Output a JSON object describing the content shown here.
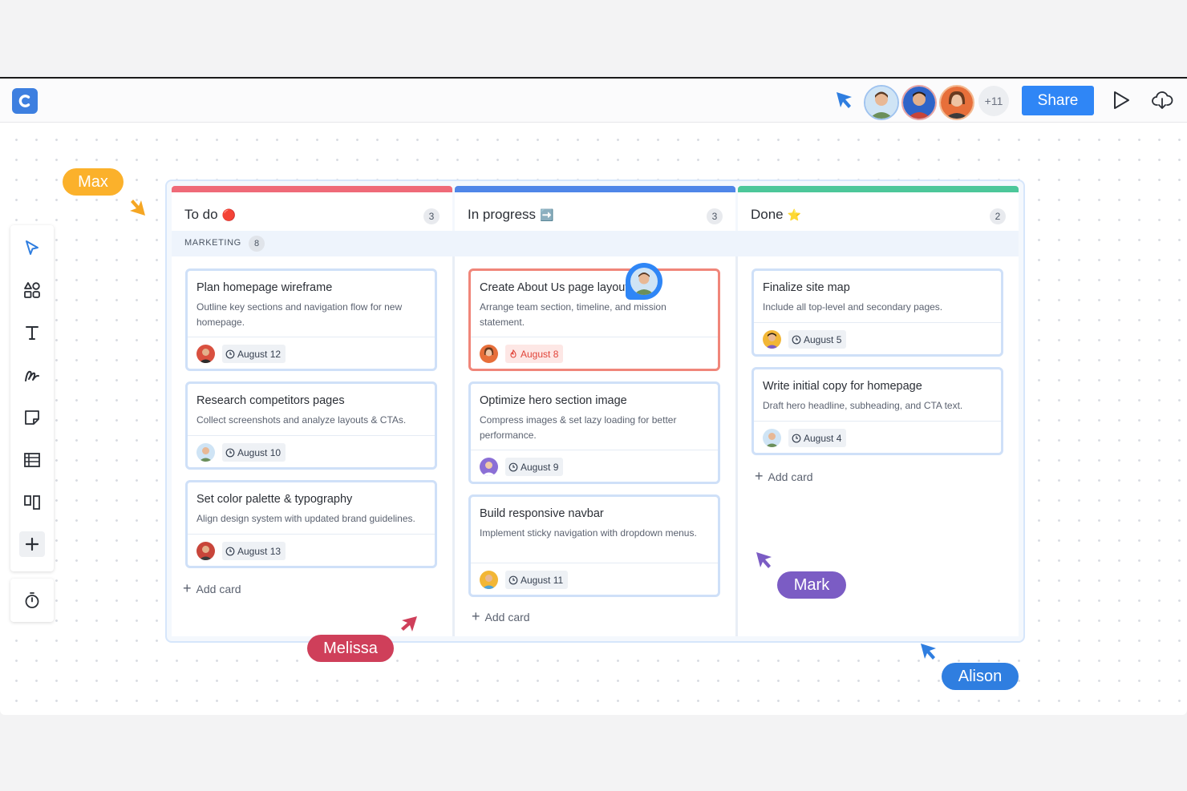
{
  "topbar": {
    "overflow_count": "+11",
    "share_label": "Share"
  },
  "board": {
    "swimlane": {
      "label": "MARKETING",
      "count": "8"
    },
    "columns": [
      {
        "title": "To do",
        "emoji": "🔴",
        "count": "3",
        "color": "#ef6a78",
        "add_label": "Add card",
        "cards": [
          {
            "title": "Plan homepage wireframe",
            "desc": "Outline key sections and navigation flow for new homepage.",
            "due": "August 12"
          },
          {
            "title": "Research competitors pages",
            "desc": "Collect screenshots and analyze layouts & CTAs.",
            "due": "August 10"
          },
          {
            "title": "Set color palette & typography",
            "desc": "Align design system with updated brand guidelines.",
            "due": "August 13"
          }
        ]
      },
      {
        "title": "In progress",
        "emoji": "➡️",
        "count": "3",
        "color": "#4f86e8",
        "add_label": "Add card",
        "cards": [
          {
            "title": "Create About Us page layout",
            "desc": "Arrange team section, timeline, and mission statement.",
            "due": "August 8"
          },
          {
            "title": "Optimize hero section image",
            "desc": "Compress images & set lazy loading for better performance.",
            "due": "August 9"
          },
          {
            "title": "Build responsive navbar",
            "desc": "Implement sticky navigation with dropdown menus.",
            "due": "August 11"
          }
        ]
      },
      {
        "title": "Done",
        "emoji": "⭐",
        "count": "2",
        "color": "#4cc79a",
        "add_label": "Add card",
        "cards": [
          {
            "title": "Finalize site map",
            "desc": "Include all top-level and secondary pages.",
            "due": "August 5"
          },
          {
            "title": "Write initial copy for homepage",
            "desc": "Draft hero headline, subheading, and CTA text.",
            "due": "August 4"
          }
        ]
      }
    ]
  },
  "collaborators": {
    "max": {
      "name": "Max",
      "color": "#fbb12b"
    },
    "melissa": {
      "name": "Melissa",
      "color": "#cf3f5a"
    },
    "mark": {
      "name": "Mark",
      "color": "#7b5cc4"
    },
    "alison": {
      "name": "Alison",
      "color": "#2f7ee0"
    }
  },
  "icons": {
    "toolbar": [
      "select-icon",
      "shapes-icon",
      "text-icon",
      "pen-icon",
      "sticky-note-icon",
      "table-icon",
      "kanban-icon",
      "plus-icon",
      "timer-icon"
    ],
    "topbar": [
      "present-icon",
      "cloud-download-icon"
    ]
  }
}
